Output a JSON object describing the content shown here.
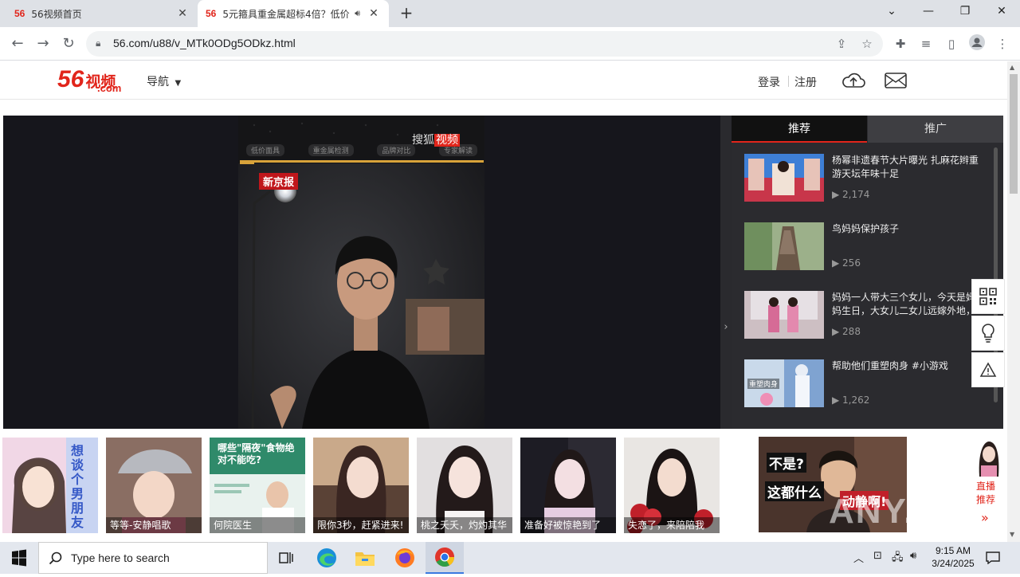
{
  "browser": {
    "tabs": [
      {
        "favicon": "56",
        "title": "56视频首页",
        "active": false
      },
      {
        "favicon": "56",
        "title": "5元箍具重金属超标4倍？低价",
        "active": true
      }
    ],
    "new_tab_icon": "plus-icon",
    "url": "56.com/u88/v_MTk0ODg5ODkz.html"
  },
  "site": {
    "logo": {
      "num": "56",
      "text": "视频",
      "com": ".com"
    },
    "nav_label": "导航",
    "login": "登录",
    "register": "注册",
    "accent": "#e1251b"
  },
  "player": {
    "watermark_brand": "搜狐",
    "watermark_brand2": "视频",
    "news_label": "新京报",
    "chapters": [
      "低价面具",
      "重金属检测",
      "品牌对比",
      "专家解读"
    ]
  },
  "side_panel": {
    "tabs": [
      "推荐",
      "推广"
    ],
    "items": [
      {
        "title": "杨幂非遗春节大片曝光 扎麻花辫重游天坛年味十足",
        "views": "2,174"
      },
      {
        "title": "鸟妈妈保护孩子",
        "views": "256"
      },
      {
        "title": "妈妈一人带大三个女儿，今天是妈妈生日，大女儿二女儿远嫁外地，",
        "views": "288"
      },
      {
        "title": "帮助他们重塑肉身 #小游戏",
        "views": "1,262"
      }
    ],
    "item3_badge": "重塑肉身"
  },
  "floating_tools": [
    "qr-code-icon",
    "lightbulb-icon",
    "warning-icon"
  ],
  "bottom_row": [
    {
      "caption": "",
      "overlay": "想谈个男朋友"
    },
    {
      "caption": "等等-安静唱歌"
    },
    {
      "caption": "何院医生",
      "overlay": "哪些\"隔夜\"食物绝对不能吃?"
    },
    {
      "caption": "限你3秒，赶紧进来!"
    },
    {
      "caption": "桃之夭夭，灼灼其华"
    },
    {
      "caption": "准备好被惊艳到了"
    },
    {
      "caption": "失恋了，来陪陪我"
    }
  ],
  "ad": {
    "line1": "不是?",
    "line2": "这都什么",
    "line3": "动静啊!"
  },
  "live": {
    "line1": "直播",
    "line2": "推荐",
    "chevron": "»"
  },
  "watermark": "ANY.RUN",
  "taskbar": {
    "search_placeholder": "Type here to search",
    "time": "9:15 AM",
    "date": "3/24/2025"
  }
}
